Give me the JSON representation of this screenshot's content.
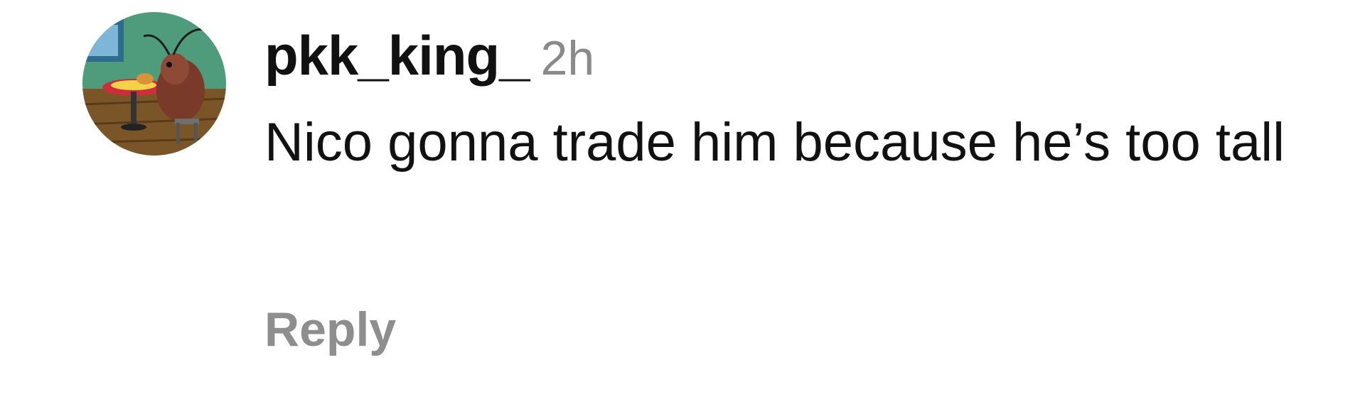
{
  "comment": {
    "avatar_icon": "profile-picture-cockroach-at-table",
    "username": "pkk_king_",
    "timestamp": "2h",
    "text": "Nico gonna trade him because he’s too tall",
    "reply_label": "Reply"
  },
  "colors": {
    "text_primary": "#111111",
    "text_secondary": "#8a8a8a",
    "background": "#ffffff"
  }
}
